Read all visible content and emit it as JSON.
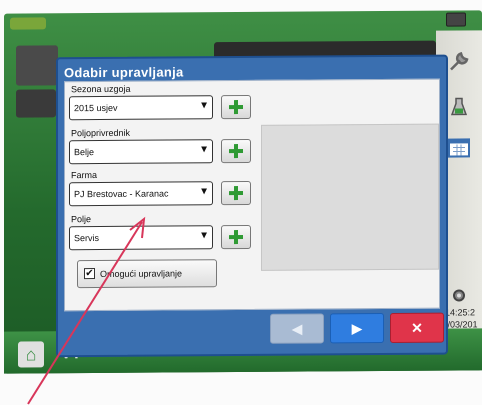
{
  "dialog": {
    "title": "Odabir upravljanja",
    "fields": [
      {
        "label": "Sezona uzgoja",
        "value": "2015 usjev"
      },
      {
        "label": "Poljoprivrednik",
        "value": "Belje"
      },
      {
        "label": "Farma",
        "value": "PJ Brestovac - Karanac"
      },
      {
        "label": "Polje",
        "value": "Servis"
      }
    ],
    "checkbox_label": "Omogući upravljanje",
    "checkbox_checked": true,
    "back_icon": "◀",
    "next_icon": "▶",
    "cancel_icon": "✕",
    "dropdown_arrow": "▼"
  },
  "status": {
    "time": "14:25:2",
    "date": "1/03/201"
  },
  "bottom": {
    "vt_label": "VT"
  },
  "icons": {
    "wrench": "🔧",
    "home": "⌂"
  },
  "colors": {
    "screen_green": "#2f7a37",
    "dialog_blue": "#3a6fb0",
    "next_blue": "#2f7de0",
    "cancel_red": "#e0344a",
    "plus_green": "#2f9a34",
    "annotation_arrow": "#d8365a"
  }
}
